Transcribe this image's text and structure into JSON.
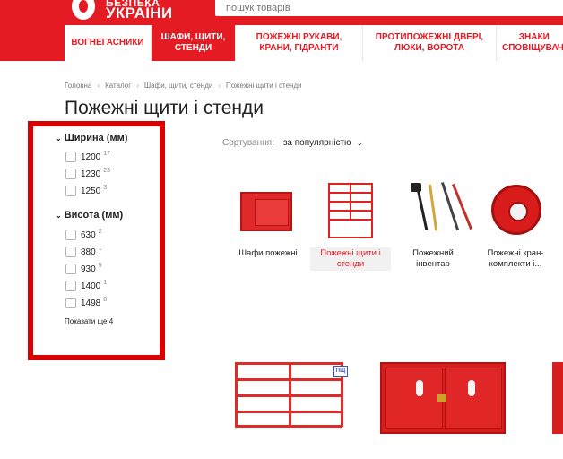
{
  "header": {
    "logo_line1": "БЕЗПЕКА",
    "logo_line2": "УКРАЇНИ",
    "search_placeholder": "пошук товарів",
    "nav": [
      {
        "label": "ВОГНЕГАСНИКИ",
        "active": false
      },
      {
        "label": "ШАФИ, ЩИТИ, СТЕНДИ",
        "active": true
      },
      {
        "label": "ПОЖЕЖНІ РУКАВИ, КРАНИ, ГІДРАНТИ",
        "active": false
      },
      {
        "label": "ПРОТИПОЖЕЖНІ ДВЕРІ, ЛЮКИ, ВОРОТА",
        "active": false
      },
      {
        "label": "ЗНАКИ СПОВІЩУВАЧІ",
        "active": false
      }
    ]
  },
  "breadcrumb": [
    "Головна",
    "Каталог",
    "Шафи, щити, стенди",
    "Пожежні щити і стенди"
  ],
  "page_title": "Пожежні щити і стенди",
  "filters": {
    "width": {
      "heading": "Ширина (мм)",
      "options": [
        {
          "value": "1200",
          "count": "17"
        },
        {
          "value": "1230",
          "count": "23"
        },
        {
          "value": "1250",
          "count": "3"
        }
      ]
    },
    "height": {
      "heading": "Висота (мм)",
      "options": [
        {
          "value": "630",
          "count": "2"
        },
        {
          "value": "880",
          "count": "1"
        },
        {
          "value": "930",
          "count": "9"
        },
        {
          "value": "1400",
          "count": "1"
        },
        {
          "value": "1498",
          "count": "8"
        }
      ]
    },
    "show_more": "Показати ще 4"
  },
  "sort": {
    "label": "Сортування:",
    "value": "за популярністю"
  },
  "categories": [
    {
      "label": "Шафи пожежні",
      "icon": "fire-cabinet-icon",
      "active": false
    },
    {
      "label": "Пожежні щити і стенди",
      "icon": "fire-stand-icon",
      "active": true
    },
    {
      "label": "Пожежний інвентар",
      "icon": "fire-tools-icon",
      "active": false
    },
    {
      "label": "Пожежні кран-комплекти і...",
      "icon": "hose-reel-icon",
      "active": false
    }
  ],
  "product_badge": "ПЩ",
  "colors": {
    "brand_red": "#e51b24",
    "highlight_box": "#d80000"
  }
}
